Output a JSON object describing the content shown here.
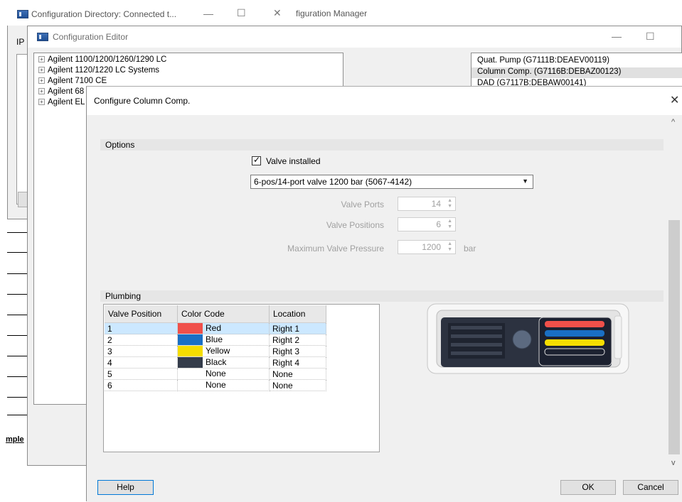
{
  "config_directory": {
    "title": "Configuration Directory: Connected t...",
    "ip_label": "IP",
    "minimize": "—",
    "maximize": "☐",
    "close": "✕"
  },
  "manager": {
    "title": "figuration Manager",
    "side_label": "mple"
  },
  "editor": {
    "title": "Configuration Editor",
    "minimize": "—",
    "maximize": "☐",
    "tree_items": [
      "Agilent 1100/1200/1260/1290 LC",
      "Agilent 1120/1220 LC Systems",
      "Agilent 7100 CE",
      "Agilent 68",
      "Agilent EL"
    ],
    "modules": [
      "Quat. Pump (G7111B:DEAEV00119)",
      "Column Comp. (G7116B:DEBAZ00123)",
      "DAD (G7117B:DEBAW00141)"
    ]
  },
  "dialog": {
    "title": "Configure Column Comp.",
    "close": "✕",
    "options_header": "Options",
    "valve_installed_label": "Valve installed",
    "valve_installed_checked": true,
    "valve_type": "6-pos/14-port valve 1200 bar (5067-4142)",
    "valve_ports_label": "Valve Ports",
    "valve_ports": "14",
    "valve_positions_label": "Valve Positions",
    "valve_positions": "6",
    "max_pressure_label": "Maximum Valve Pressure",
    "max_pressure": "1200",
    "pressure_unit": "bar",
    "plumbing_header": "Plumbing",
    "columns": [
      "Valve Position",
      "Color Code",
      "Location"
    ],
    "rows": [
      {
        "pos": "1",
        "color_name": "Red",
        "color": "#f0504a",
        "location": "Right 1"
      },
      {
        "pos": "2",
        "color_name": "Blue",
        "color": "#1a6fc4",
        "location": "Right 2"
      },
      {
        "pos": "3",
        "color_name": "Yellow",
        "color": "#f5dd00",
        "location": "Right 3"
      },
      {
        "pos": "4",
        "color_name": "Black",
        "color": "#343c4a",
        "location": "Right 4"
      },
      {
        "pos": "5",
        "color_name": "None",
        "color": "",
        "location": "None"
      },
      {
        "pos": "6",
        "color_name": "None",
        "color": "",
        "location": "None"
      }
    ],
    "help_label": "Help",
    "ok_label": "OK",
    "cancel_label": "Cancel",
    "scroll_up": "^",
    "scroll_down": "v"
  }
}
